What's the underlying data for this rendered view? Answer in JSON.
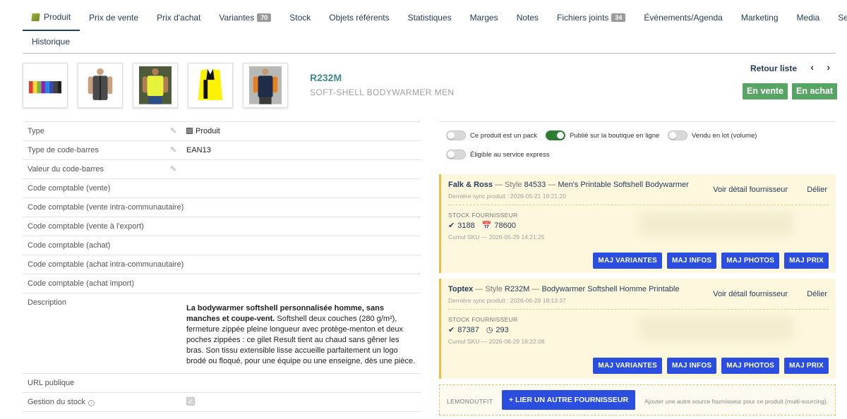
{
  "tabs": {
    "items": [
      {
        "label": "Produit",
        "badge": null,
        "active": true
      },
      {
        "label": "Prix de vente",
        "badge": null
      },
      {
        "label": "Prix d'achat",
        "badge": null
      },
      {
        "label": "Variantes",
        "badge": "70"
      },
      {
        "label": "Stock",
        "badge": null
      },
      {
        "label": "Objets référents",
        "badge": null
      },
      {
        "label": "Statistiques",
        "badge": null
      },
      {
        "label": "Marges",
        "badge": null
      },
      {
        "label": "Notes",
        "badge": null
      },
      {
        "label": "Fichiers joints",
        "badge": "34"
      },
      {
        "label": "Événements/Agenda",
        "badge": null
      },
      {
        "label": "Marketing",
        "badge": null
      },
      {
        "label": "Media",
        "badge": null
      },
      {
        "label": "Services liés",
        "badge": null
      }
    ],
    "row2": [
      {
        "label": "Historique"
      }
    ]
  },
  "product": {
    "ref": "R232M",
    "name": "SOFT-SHELL BODYWARMER MEN",
    "thumbnail_icons": [
      "colour-range-vests-image",
      "model-grey-vest-image",
      "model-yellow-vest-image",
      "yellow-vest-image",
      "model-navy-vest-image"
    ]
  },
  "nav": {
    "retour": "Retour liste",
    "prev_icon": "‹",
    "next_icon": "›"
  },
  "status": {
    "vente": "En vente",
    "achat": "En achat"
  },
  "attributes": [
    {
      "label": "Type",
      "value": "Produit",
      "editable": true
    },
    {
      "label": "Type de code-barres",
      "value": "EAN13",
      "editable": true
    },
    {
      "label": "Valeur du code-barres",
      "value": "",
      "editable": true
    },
    {
      "label": "Code comptable (vente)",
      "value": ""
    },
    {
      "label": "Code comptable (vente intra-communautaire)",
      "value": ""
    },
    {
      "label": "Code comptable (vente à l'export)",
      "value": ""
    },
    {
      "label": "Code comptable (achat)",
      "value": ""
    },
    {
      "label": "Code comptable (achat intra-communautaire)",
      "value": ""
    },
    {
      "label": "Code comptable (achat import)",
      "value": ""
    }
  ],
  "description": {
    "label": "Description",
    "bold": "La bodywarmer softshell personnalisée homme, sans manches et coupe-vent.",
    "text": " Softshell deux couches (280 g/m²), fermeture zippée pleine longueur avec protège-menton et deux poches zippées : ce gilet Result tient au chaud sans gêner les bras. Son tissu extensible lisse accueille parfaitement un logo brodé ou floqué, pour une équipe ou une enseigne, dès une pièce."
  },
  "url_publique": {
    "label": "URL publique"
  },
  "gestion_stock": {
    "label": "Gestion du stock",
    "info": "i",
    "check": "✓"
  },
  "toggles": [
    {
      "label": "Ce produit est un pack",
      "on": false
    },
    {
      "label": "Publié sur la boutique en ligne",
      "on": true
    },
    {
      "label": "Vendu en lot (volume)",
      "on": false
    },
    {
      "label": "Éligible au service express",
      "on": false
    }
  ],
  "suppliers": [
    {
      "name": "Falk & Ross",
      "sep1": " — Style ",
      "style": "84533",
      "sep2": " — ",
      "product": "Men's Printable Softshell Bodywarmer",
      "sync": "Dernière sync produit : 2026-05-21 19:21:20",
      "stock_label": "STOCK FOURNISSEUR",
      "stock_main": "3188",
      "stock_second": "78600",
      "stock_second_icon": "calendar-icon",
      "cumul": "Cumul SKU — 2026-05-29 14:21:25",
      "detail_link": "Voir détail fournisseur",
      "delier_link": "Délier",
      "buttons": [
        "MAJ VARIANTES",
        "MAJ INFOS",
        "MAJ PHOTOS",
        "MAJ PRIX"
      ]
    },
    {
      "name": "Toptex",
      "sep1": " — Style ",
      "style": "R232M",
      "sep2": " — ",
      "product": "Bodywarmer Softshell Homme Printable",
      "sync": "Dernière sync produit : 2026-06-29 18:13:37",
      "stock_label": "STOCK FOURNISSEUR",
      "stock_main": "87387",
      "stock_second": "293",
      "stock_second_icon": "clock-icon",
      "cumul": "Cumul SKU — 2026-06-29 16:22:08",
      "detail_link": "Voir détail fournisseur",
      "delier_link": "Délier",
      "buttons": [
        "MAJ VARIANTES",
        "MAJ INFOS",
        "MAJ PHOTOS",
        "MAJ PRIX"
      ]
    }
  ],
  "add_supplier": {
    "label": "LEMONOUTFIT",
    "button": "+ LIER UN AUTRE FOURNISSEUR",
    "hint": "Ajouter une autre source fournisseur pour ce produit (multi-sourcing)."
  },
  "colors": {
    "accent": "#263c5c",
    "status_green": "#57a565",
    "button_blue": "#2b4ee0",
    "supplier_bg": "#fdf7dd",
    "teal_ref": "#3e8b91"
  }
}
